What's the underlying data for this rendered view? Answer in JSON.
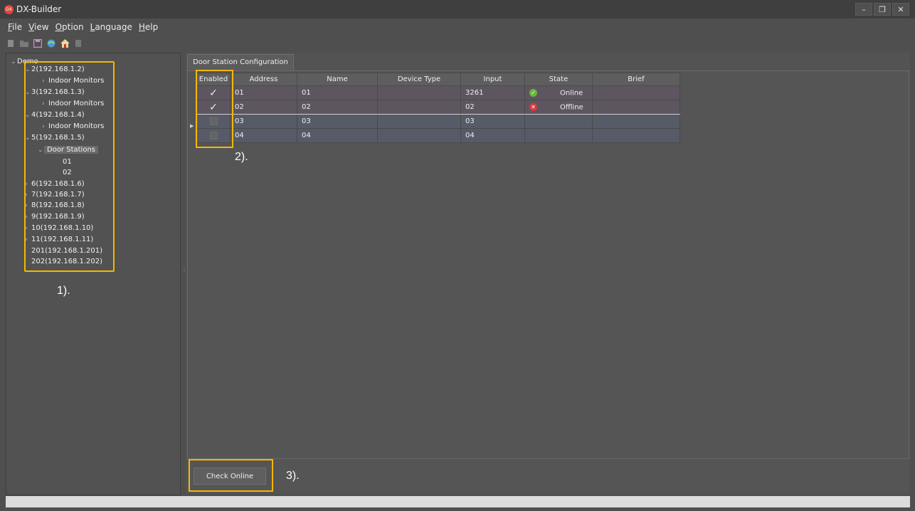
{
  "window": {
    "title": "DX-Builder",
    "logo_text": "DX",
    "controls": [
      "–",
      "❐",
      "✕"
    ]
  },
  "menu": [
    {
      "key": "F",
      "rest": "ile"
    },
    {
      "key": "V",
      "rest": "iew"
    },
    {
      "key": "O",
      "rest": "ption"
    },
    {
      "key": "L",
      "rest": "anguage"
    },
    {
      "key": "H",
      "rest": "elp"
    }
  ],
  "toolbar": {
    "icons": [
      "new-file-icon",
      "open-folder-icon",
      "save-icon",
      "globe-icon",
      "home-icon",
      "database-icon"
    ]
  },
  "tree": {
    "root": "Demo",
    "nodes": [
      "2(192.168.1.2)",
      "Indoor Monitors",
      "3(192.168.1.3)",
      "Indoor Monitors",
      "4(192.168.1.4)",
      "Indoor Monitors",
      "5(192.168.1.5)",
      "Door Stations",
      "01",
      "02",
      "6(192.168.1.6)",
      "7(192.168.1.7)",
      "8(192.168.1.8)",
      "9(192.168.1.9)",
      "10(192.168.1.10)",
      "11(192.168.1.11)",
      "201(192.168.1.201)",
      "202(192.168.1.202)"
    ]
  },
  "tab": {
    "label": "Door Station Configuration"
  },
  "table": {
    "columns": [
      "Enabled",
      "Address",
      "Name",
      "Device Type",
      "Input",
      "State",
      "Brief"
    ],
    "rows": [
      {
        "enabled": true,
        "address": "01",
        "name": "01",
        "device_type": "",
        "input": "3261",
        "state": "Online",
        "brief": ""
      },
      {
        "enabled": true,
        "address": "02",
        "name": "02",
        "device_type": "",
        "input": "02",
        "state": "Offline",
        "brief": ""
      },
      {
        "enabled": false,
        "address": "03",
        "name": "03",
        "device_type": "",
        "input": "03",
        "state": "",
        "brief": ""
      },
      {
        "enabled": false,
        "address": "04",
        "name": "04",
        "device_type": "",
        "input": "04",
        "state": "",
        "brief": ""
      }
    ]
  },
  "buttons": {
    "check_online": "Check Online"
  },
  "annotations": {
    "one": "1).",
    "two": "2).",
    "three": "3)."
  },
  "colors": {
    "annotation_box": "#f5b800",
    "online": "#67b83b",
    "offline": "#d9393b"
  }
}
